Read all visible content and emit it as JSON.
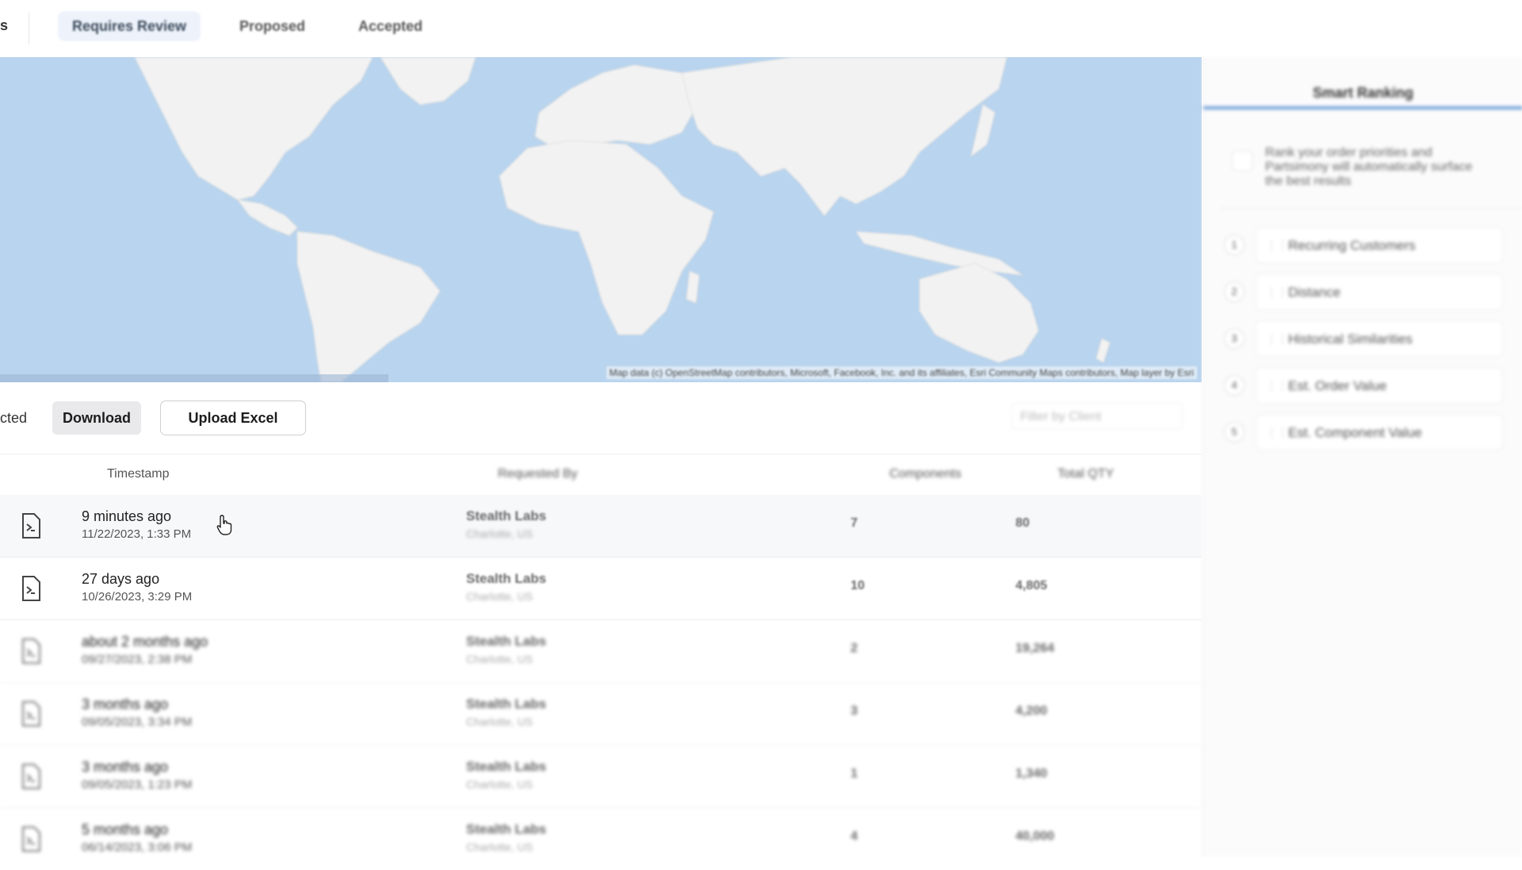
{
  "tabs": {
    "partial_label": "s",
    "items": [
      {
        "label": "Requires Review",
        "active": true
      },
      {
        "label": "Proposed",
        "active": false
      },
      {
        "label": "Accepted",
        "active": false
      }
    ]
  },
  "map": {
    "attribution": "Map data (c) OpenStreetMap contributors, Microsoft, Facebook, Inc. and its affiliates, Esri Community Maps contributors, Map layer by Esri",
    "water_color": "#b9d4ee",
    "land_color": "#f2f2f2"
  },
  "panel": {
    "title": "Smart Ranking",
    "description": "Rank your order priorities and Partsimony will automatically surface the best results",
    "ranks": [
      {
        "num": "1",
        "label": "Recurring Customers"
      },
      {
        "num": "2",
        "label": "Distance"
      },
      {
        "num": "3",
        "label": "Historical Similarities"
      },
      {
        "num": "4",
        "label": "Est. Order Value"
      },
      {
        "num": "5",
        "label": "Est. Component Value"
      }
    ]
  },
  "toolbar": {
    "partial_button": "cted",
    "download": "Download",
    "upload": "Upload Excel",
    "filter_placeholder": "Filter by Client"
  },
  "table": {
    "headers": {
      "timestamp": "Timestamp",
      "requested_by": "Requested By",
      "components": "Components",
      "total_qty": "Total QTY"
    },
    "rows": [
      {
        "relative": "9 minutes ago",
        "date": "11/22/2023, 1:33 PM",
        "client": "Stealth Labs",
        "location": "Charlotte, US",
        "components": "7",
        "qty": "80"
      },
      {
        "relative": "27 days ago",
        "date": "10/26/2023, 3:29 PM",
        "client": "Stealth Labs",
        "location": "Charlotte, US",
        "components": "10",
        "qty": "4,805"
      },
      {
        "relative": "about 2 months ago",
        "date": "09/27/2023, 2:38 PM",
        "client": "Stealth Labs",
        "location": "Charlotte, US",
        "components": "2",
        "qty": "19,264"
      },
      {
        "relative": "3 months ago",
        "date": "09/05/2023, 3:34 PM",
        "client": "Stealth Labs",
        "location": "Charlotte, US",
        "components": "3",
        "qty": "4,200"
      },
      {
        "relative": "3 months ago",
        "date": "09/05/2023, 1:23 PM",
        "client": "Stealth Labs",
        "location": "Charlotte, US",
        "components": "1",
        "qty": "1,340"
      },
      {
        "relative": "5 months ago",
        "date": "06/14/2023, 3:06 PM",
        "client": "Stealth Labs",
        "location": "Charlotte, US",
        "components": "4",
        "qty": "40,000"
      }
    ]
  }
}
